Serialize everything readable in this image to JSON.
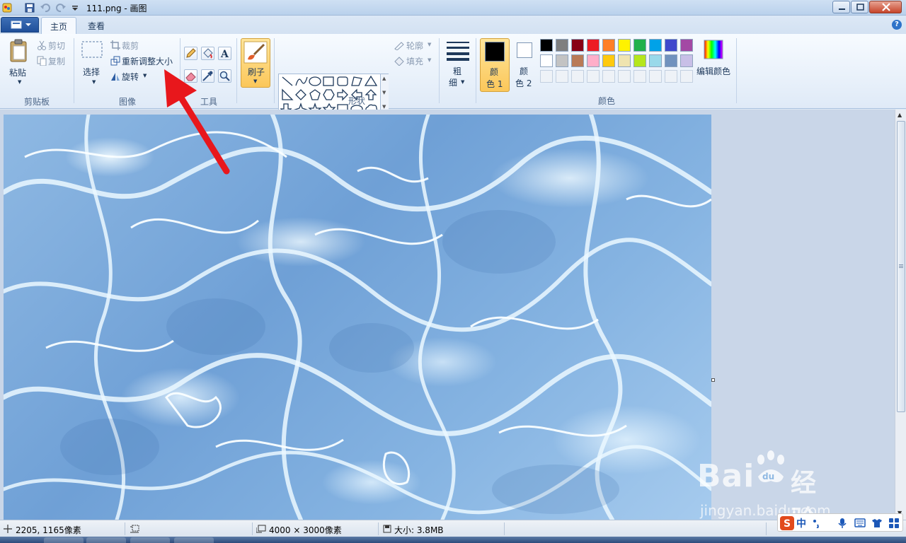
{
  "window": {
    "title": "111.png - 画图"
  },
  "tabs": [
    {
      "label": "主页",
      "active": true
    },
    {
      "label": "查看",
      "active": false
    }
  ],
  "ribbon": {
    "clipboard": {
      "paste": "粘贴",
      "cut": "剪切",
      "copy": "复制",
      "group_label": "剪贴板"
    },
    "image": {
      "select": "选择",
      "crop": "裁剪",
      "resize": "重新调整大小",
      "rotate": "旋转",
      "group_label": "图像"
    },
    "tools": {
      "group_label": "工具"
    },
    "brushes": {
      "label": "刷子"
    },
    "shapes": {
      "outline": "轮廓",
      "fill": "填充",
      "group_label": "形状"
    },
    "size": {
      "label_line1": "粗",
      "label_line2": "细"
    },
    "colors": {
      "color1_line1": "颜",
      "color1_line2": "色 1",
      "color2_line1": "颜",
      "color2_line2": "色 2",
      "edit": "编辑颜色",
      "group_label": "颜色",
      "color1_value": "#000000",
      "color2_value": "#ffffff",
      "palette_row1": [
        "#000000",
        "#7f7f7f",
        "#880015",
        "#ed1c24",
        "#ff7f27",
        "#fff200",
        "#22b14c",
        "#00a2e8",
        "#3f48cc",
        "#a349a4"
      ],
      "palette_row2": [
        "#ffffff",
        "#c3c3c3",
        "#b97a57",
        "#ffaec9",
        "#ffc90e",
        "#efe4b0",
        "#b5e61d",
        "#99d9ea",
        "#7092be",
        "#c8bfe7"
      ]
    }
  },
  "statusbar": {
    "cursor_pos": "2205, 1165像素",
    "image_size": "4000 × 3000像素",
    "file_size": "大小: 3.8MB"
  },
  "watermark": {
    "brand": "Bai",
    "brand2": "经验",
    "url": "jingyan.baidu.com"
  },
  "ime": {
    "lang": "中"
  }
}
